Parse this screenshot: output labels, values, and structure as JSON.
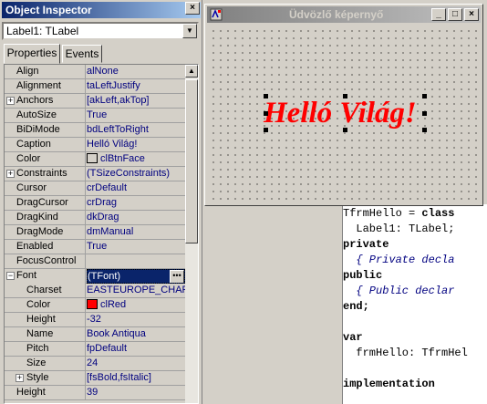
{
  "inspector": {
    "title": "Object Inspector",
    "close_glyph": "×",
    "component_selector": "Label1: TLabel",
    "tabs": [
      "Properties",
      "Events"
    ],
    "rows": [
      {
        "name": "Align",
        "value": "alNone"
      },
      {
        "name": "Alignment",
        "value": "taLeftJustify"
      },
      {
        "name": "Anchors",
        "value": "[akLeft,akTop]",
        "expander": "+"
      },
      {
        "name": "AutoSize",
        "value": "True"
      },
      {
        "name": "BiDiMode",
        "value": "bdLeftToRight"
      },
      {
        "name": "Caption",
        "value": "Helló Világ!"
      },
      {
        "name": "Color",
        "value": "clBtnFace",
        "swatch": "#d4d0c8"
      },
      {
        "name": "Constraints",
        "value": "(TSizeConstraints)",
        "expander": "+"
      },
      {
        "name": "Cursor",
        "value": "crDefault"
      },
      {
        "name": "DragCursor",
        "value": "crDrag"
      },
      {
        "name": "DragKind",
        "value": "dkDrag"
      },
      {
        "name": "DragMode",
        "value": "dmManual"
      },
      {
        "name": "Enabled",
        "value": "True"
      },
      {
        "name": "FocusControl",
        "value": ""
      },
      {
        "name": "Font",
        "value": "(TFont)",
        "expander": "−",
        "selected": true
      },
      {
        "name": "Charset",
        "value": "EASTEUROPE_CHAR",
        "sub": true
      },
      {
        "name": "Color",
        "value": "clRed",
        "sub": true,
        "swatch": "#ff0000"
      },
      {
        "name": "Height",
        "value": "-32",
        "sub": true
      },
      {
        "name": "Name",
        "value": "Book Antiqua",
        "sub": true
      },
      {
        "name": "Pitch",
        "value": "fpDefault",
        "sub": true
      },
      {
        "name": "Size",
        "value": "24",
        "sub": true
      },
      {
        "name": "Style",
        "value": "[fsBold,fsItalic]",
        "sub": true,
        "expander": "+"
      },
      {
        "name": "Height",
        "value": "39"
      }
    ]
  },
  "form": {
    "title": "Üdvözlő képernyő",
    "label_caption": "Helló Világ!",
    "buttons": {
      "minimize": "_",
      "maximize": "□",
      "close": "×"
    }
  },
  "colors": {
    "active_title": "#0a246a",
    "inactive_title": "#808080",
    "label_color": "#ff0000"
  },
  "code": {
    "lines": [
      {
        "parts": [
          {
            "t": "TfrmHello = ",
            "s": ""
          },
          {
            "t": "class",
            "s": "kw"
          }
        ]
      },
      {
        "parts": [
          {
            "t": "  Label1: TLabel;",
            "s": ""
          }
        ]
      },
      {
        "parts": [
          {
            "t": "private",
            "s": "kw"
          }
        ]
      },
      {
        "parts": [
          {
            "t": "  { Private decla",
            "s": "cm"
          }
        ]
      },
      {
        "parts": [
          {
            "t": "public",
            "s": "kw"
          }
        ]
      },
      {
        "parts": [
          {
            "t": "  { Public declar",
            "s": "cm"
          }
        ]
      },
      {
        "parts": [
          {
            "t": "end;",
            "s": "kw"
          }
        ]
      },
      {
        "parts": [
          {
            "t": "",
            "s": ""
          }
        ]
      },
      {
        "parts": [
          {
            "t": "var",
            "s": "kw"
          }
        ]
      },
      {
        "parts": [
          {
            "t": "  frmHello: TfrmHel",
            "s": ""
          }
        ]
      },
      {
        "parts": [
          {
            "t": "",
            "s": ""
          }
        ]
      },
      {
        "parts": [
          {
            "t": "implementation",
            "s": "kw"
          }
        ]
      }
    ]
  }
}
